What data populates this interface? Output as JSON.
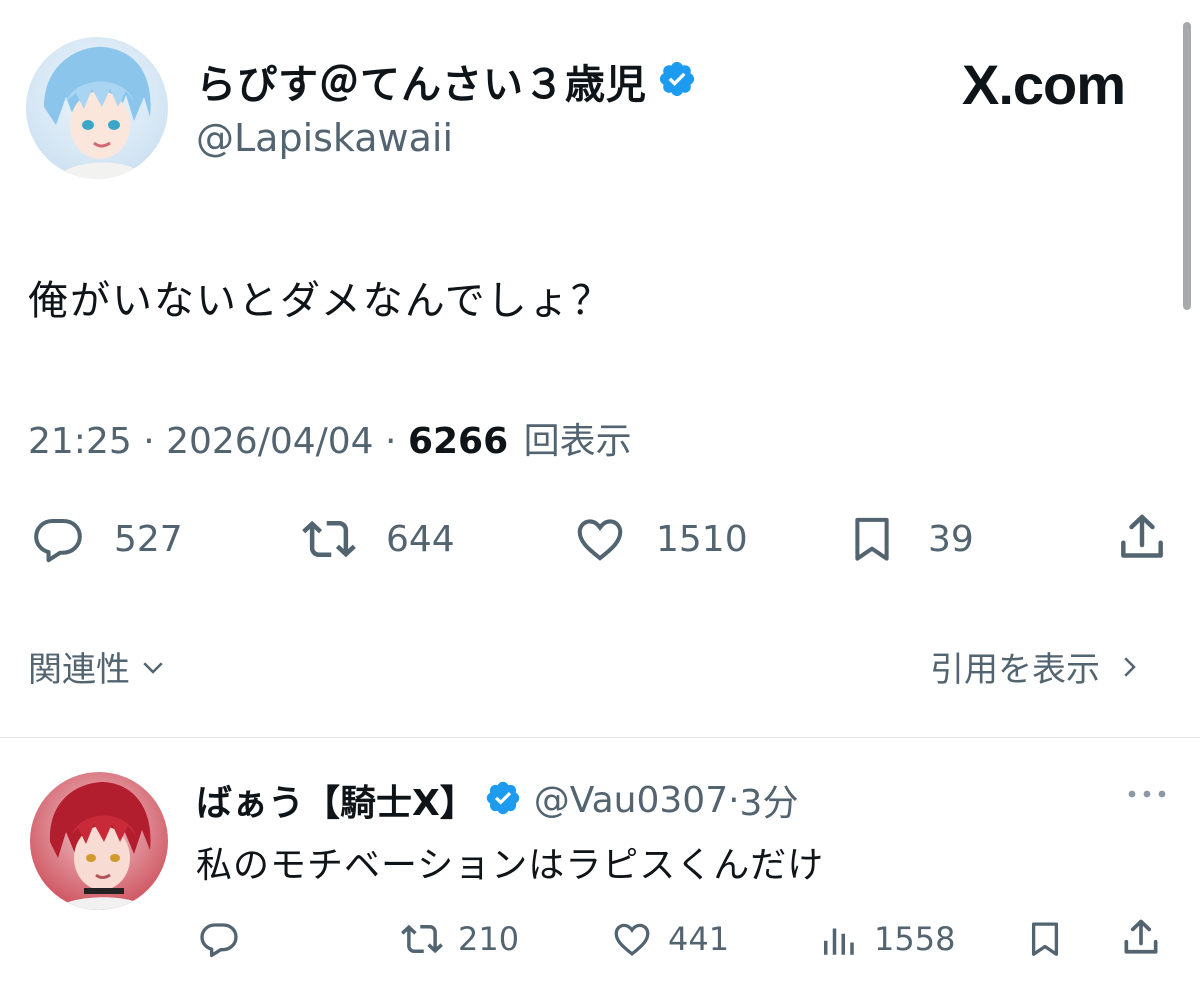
{
  "tweet": {
    "author_name": "らぴす＠てんさい３歳児",
    "author_handle": "@Lapiskawaii",
    "site_label": "X.com",
    "text": "俺がいないとダメなんでしょ？",
    "time": "21:25",
    "date": "2026/04/04",
    "views": "6266",
    "views_label": "回表示",
    "stats": {
      "replies": "527",
      "reposts": "644",
      "likes": "1510",
      "bookmarks": "39"
    }
  },
  "links": {
    "relevance": "関連性",
    "show_quotes": "引用を表示"
  },
  "reply": {
    "author_name": "ばぁう【騎士X】",
    "author_handle": "@Vau0307",
    "time": "3分",
    "text": "私のモチベーションはラピスくんだけ",
    "stats": {
      "reposts": "210",
      "likes": "441",
      "views": "1558"
    }
  },
  "colors": {
    "verified": "#1d9bf0",
    "text": "#0f1419",
    "muted": "#536471"
  },
  "icons": [
    "verified-badge-icon",
    "reply-icon",
    "repost-icon",
    "like-icon",
    "bookmark-icon",
    "share-icon",
    "chevron-down-icon",
    "chevron-right-icon",
    "more-icon",
    "views-icon"
  ]
}
